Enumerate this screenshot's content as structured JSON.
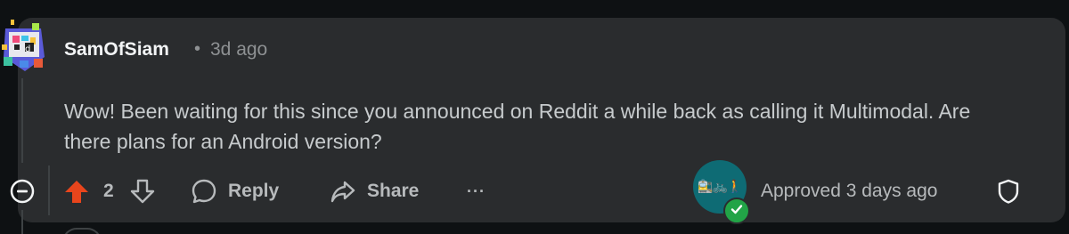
{
  "comment": {
    "author": "SamOfSiam",
    "separator": "•",
    "timestamp": "3d ago",
    "body": "Wow! Been waiting for this since you announced on Reddit a while back as calling it Multimodal. Are there plans for an Android version?"
  },
  "actions": {
    "vote_count": "2",
    "reply_label": "Reply",
    "share_label": "Share",
    "more_label": "···"
  },
  "moderation": {
    "mod_icons": "🚉🚲🚶",
    "status": "Approved 3 days ago"
  },
  "colors": {
    "upvote_active": "#e8451c",
    "approved_green": "#22a447",
    "mod_avatar_bg": "#0e6b74"
  },
  "icons": {
    "avatar": "user-avatar-pixel-art",
    "collapse": "collapse-minus-icon",
    "upvote": "arrow-up-icon",
    "downvote": "arrow-down-icon",
    "reply": "speech-bubble-icon",
    "share": "share-arrow-icon",
    "more": "ellipsis-icon",
    "shield": "shield-icon",
    "check": "checkmark-icon"
  }
}
